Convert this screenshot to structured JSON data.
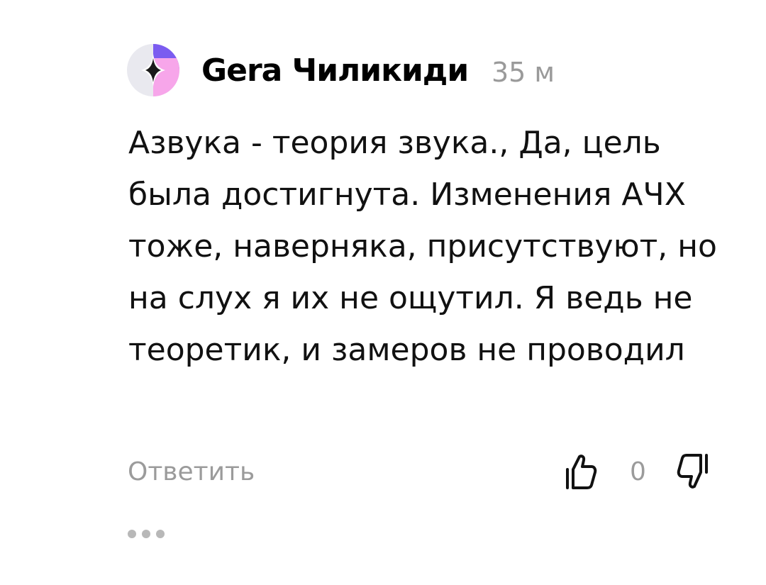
{
  "comment": {
    "author": "Gera Чиликиди",
    "time": "35 м",
    "text": "Азвука - теория звука., Да, цель была достигнута. Изменения АЧХ тоже, наверняка, присутствуют, но на слух я их не ощутил. Я ведь не теоретик, и замеров не проводил",
    "reply_label": "Ответить",
    "likes": "0"
  },
  "icons": {
    "avatar": "avatar-star-icon",
    "like": "thumbs-up-icon",
    "dislike": "thumbs-down-icon",
    "more": "more-dots-icon"
  },
  "colors": {
    "avatar_pink": "#f7a6ea",
    "avatar_purple": "#7b5cf0",
    "avatar_bg": "#e9e9ef",
    "muted_text": "#9b9b9b"
  }
}
